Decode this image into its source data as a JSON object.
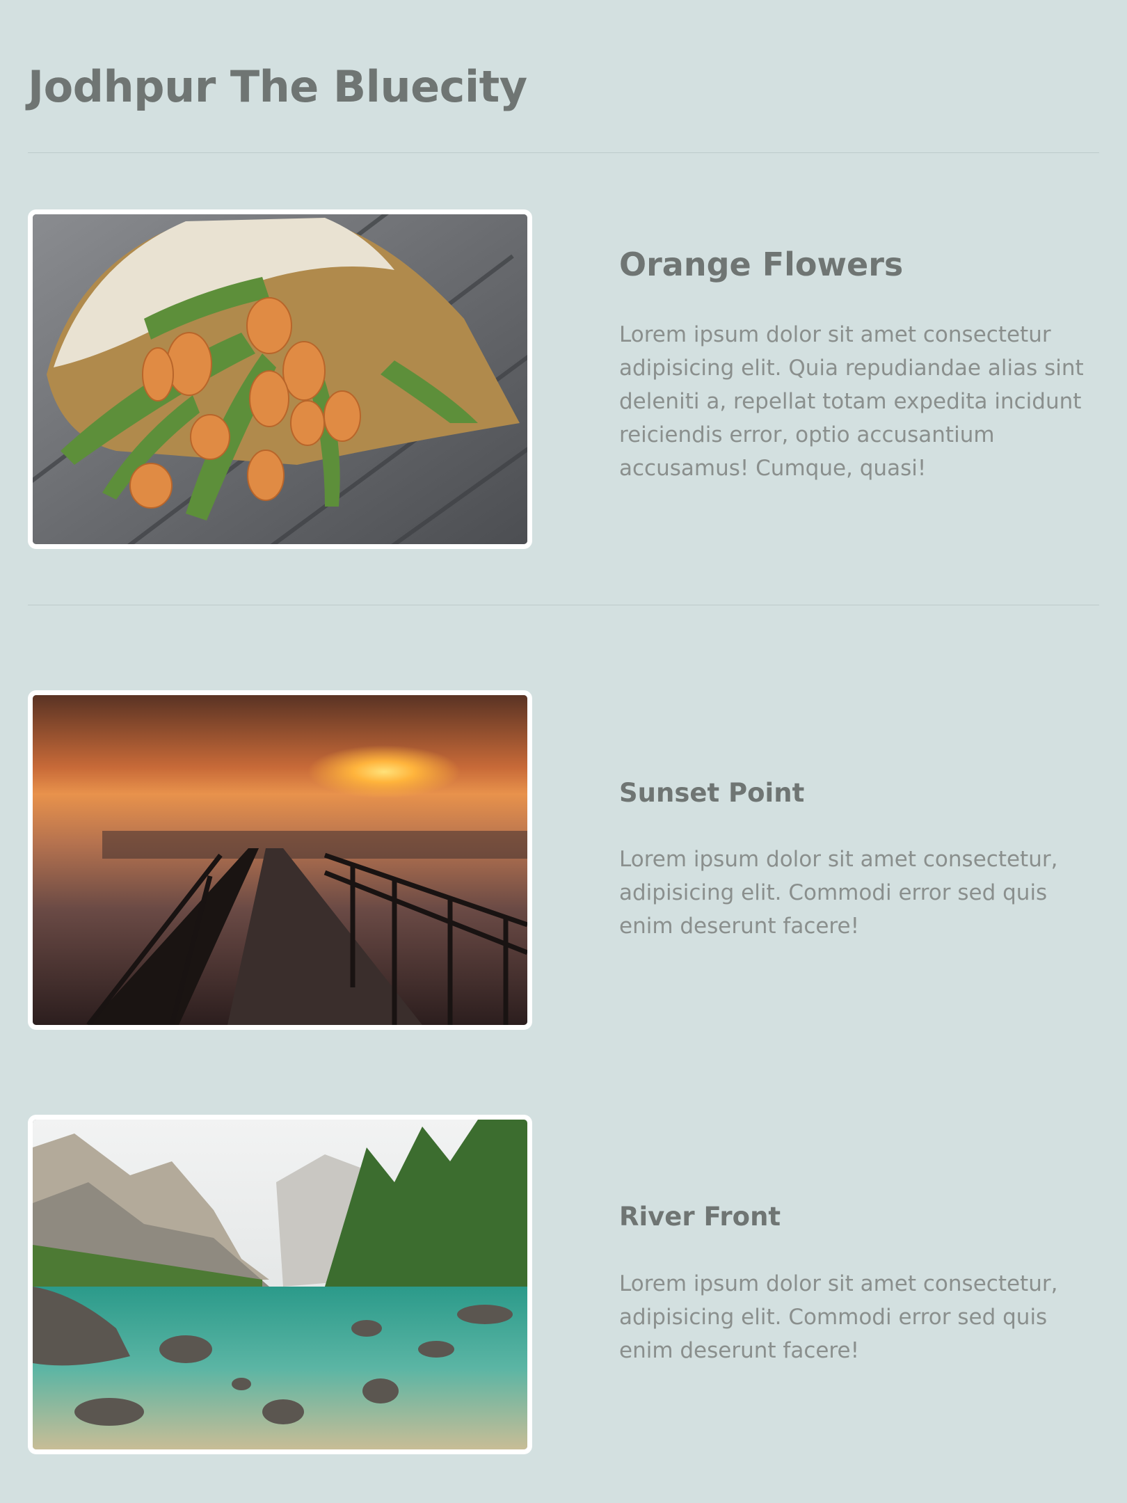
{
  "page": {
    "title": "Jodhpur The Bluecity"
  },
  "cards": [
    {
      "image": "orange-tulips-bouquet-image",
      "title": "Orange Flowers",
      "text": "Lorem ipsum dolor sit amet consectetur adipisicing elit. Quia repudiandae alias sint deleniti a, repellat totam expedita incidunt reiciendis error, optio accusantium accusamus! Cumque, quasi!"
    },
    {
      "image": "sunset-pier-image",
      "title": "Sunset Point",
      "text": "Lorem ipsum dolor sit amet consectetur, adipisicing elit. Commodi error sed quis enim deserunt facere!"
    },
    {
      "image": "mountain-lake-image",
      "title": "River Front",
      "text": "Lorem ipsum dolor sit amet consectetur, adipisicing elit. Commodi error sed quis enim deserunt facere!"
    }
  ],
  "colors": {
    "background": "#d3e0e0",
    "heading": "#6f7573",
    "body_text": "#8a8f8d",
    "divider": "#bdcbcb",
    "frame": "#ffffff"
  }
}
